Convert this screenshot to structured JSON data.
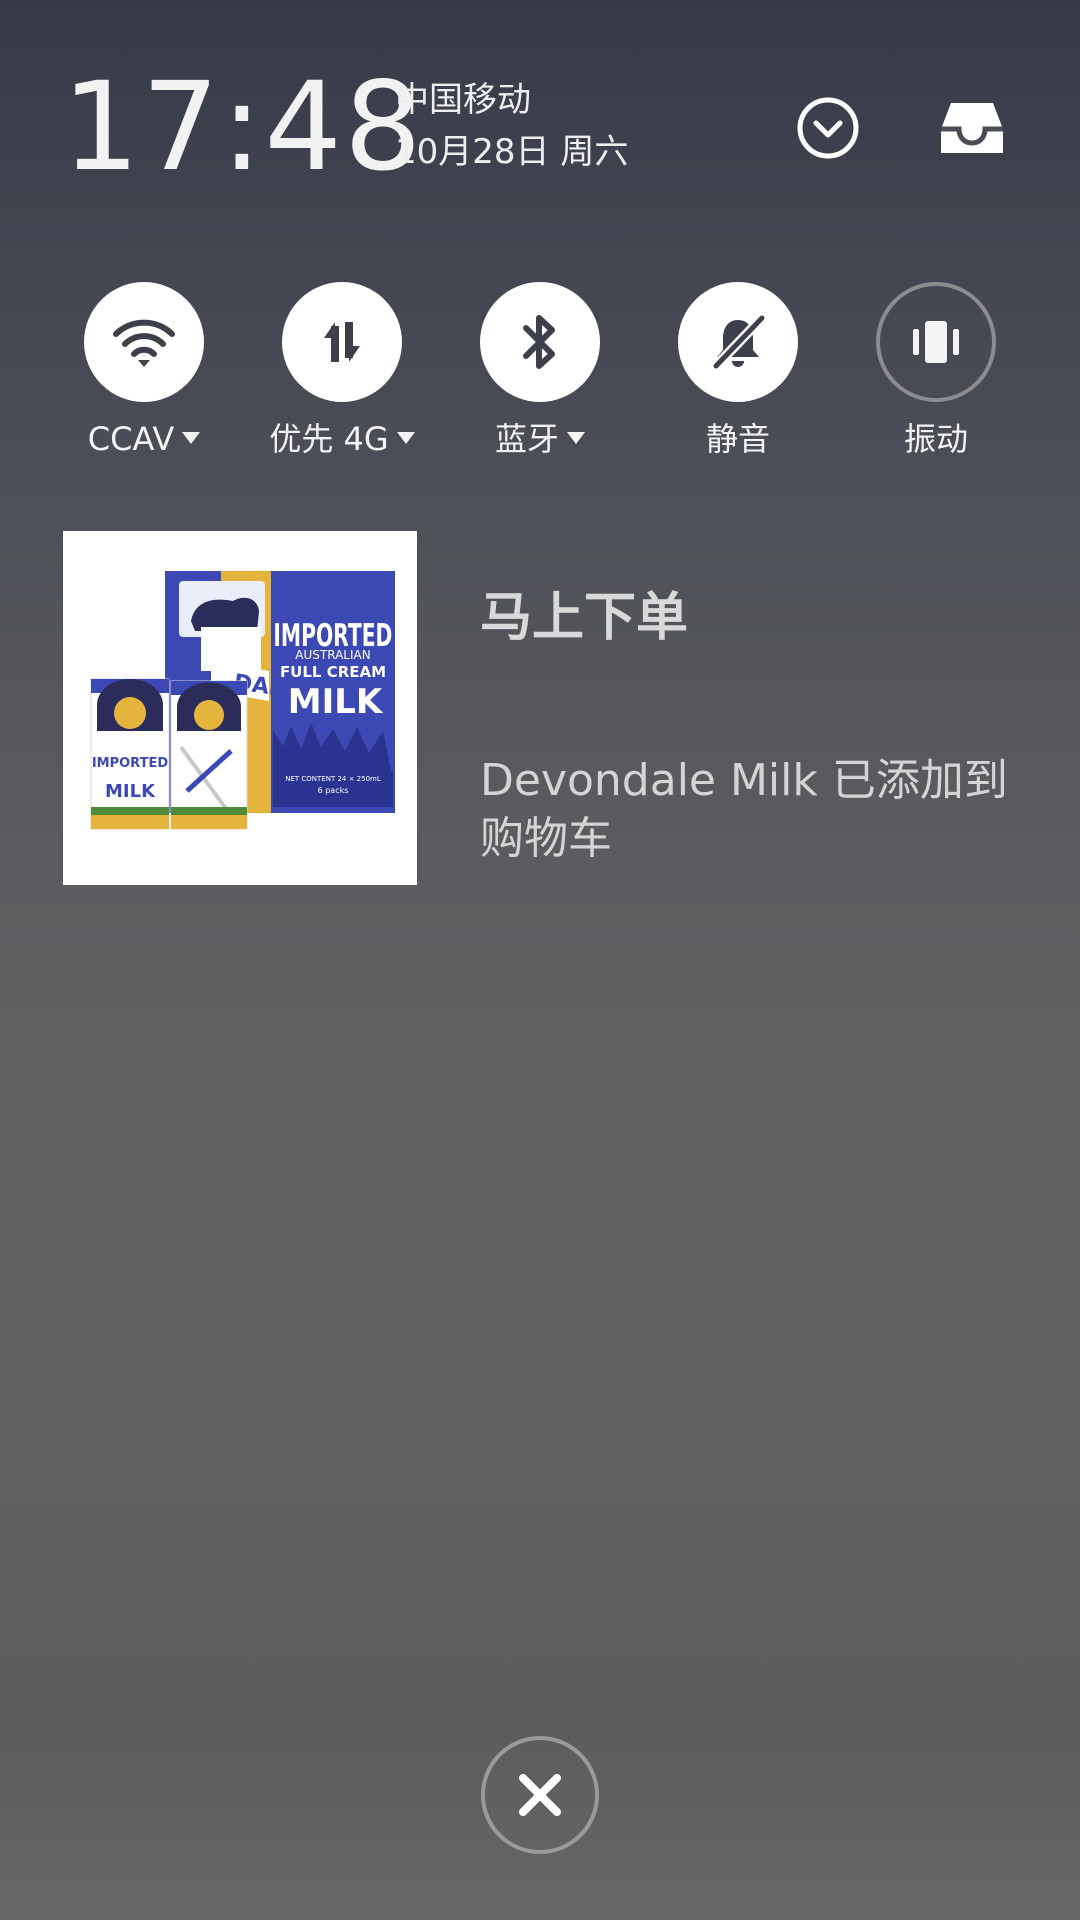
{
  "status": {
    "time": "17:48",
    "carrier": "中国移动",
    "date": "10月28日 周六"
  },
  "header_icons": [
    {
      "name": "collapse-icon",
      "icon": "chevron-down-circle"
    },
    {
      "name": "notification-inbox-icon",
      "icon": "inbox-tray"
    }
  ],
  "quick_settings": {
    "tiles": [
      {
        "label": "CCAV",
        "icon": "wifi-icon",
        "active": true,
        "has_dropdown": true
      },
      {
        "label": "优先 4G",
        "icon": "mobile-data-icon",
        "active": true,
        "has_dropdown": true
      },
      {
        "label": "蓝牙",
        "icon": "bluetooth-icon",
        "active": true,
        "has_dropdown": true
      },
      {
        "label": "静音",
        "icon": "mute-bell-icon",
        "active": true,
        "has_dropdown": false
      },
      {
        "label": "振动",
        "icon": "vibrate-icon",
        "active": false,
        "has_dropdown": false
      }
    ]
  },
  "notification": {
    "title": "马上下单",
    "body": "Devondale Milk 已添加到购物车",
    "image": {
      "box_text_1": "IMPORTED",
      "box_text_2": "AUSTRALIAN",
      "box_text_3": "FULL CREAM",
      "box_text_4": "MILK",
      "box_brand": "DALE",
      "box_footer_1": "NET CONTENT 24 × 250mL",
      "box_footer_2": "6 packs",
      "carton_text_1": "IMPORTED",
      "carton_text_2": "MILK"
    }
  },
  "controls": {
    "close_icon": "close-icon"
  },
  "colors": {
    "tile_on": "#ffffff",
    "tile_icon": "#3d404a",
    "tile_off_border": "#8b8c90",
    "text_primary": "#f2f2f2",
    "text_notification": "#d4d4d4",
    "milk_blue": "#3c48b4",
    "milk_gold": "#e4b43c"
  }
}
